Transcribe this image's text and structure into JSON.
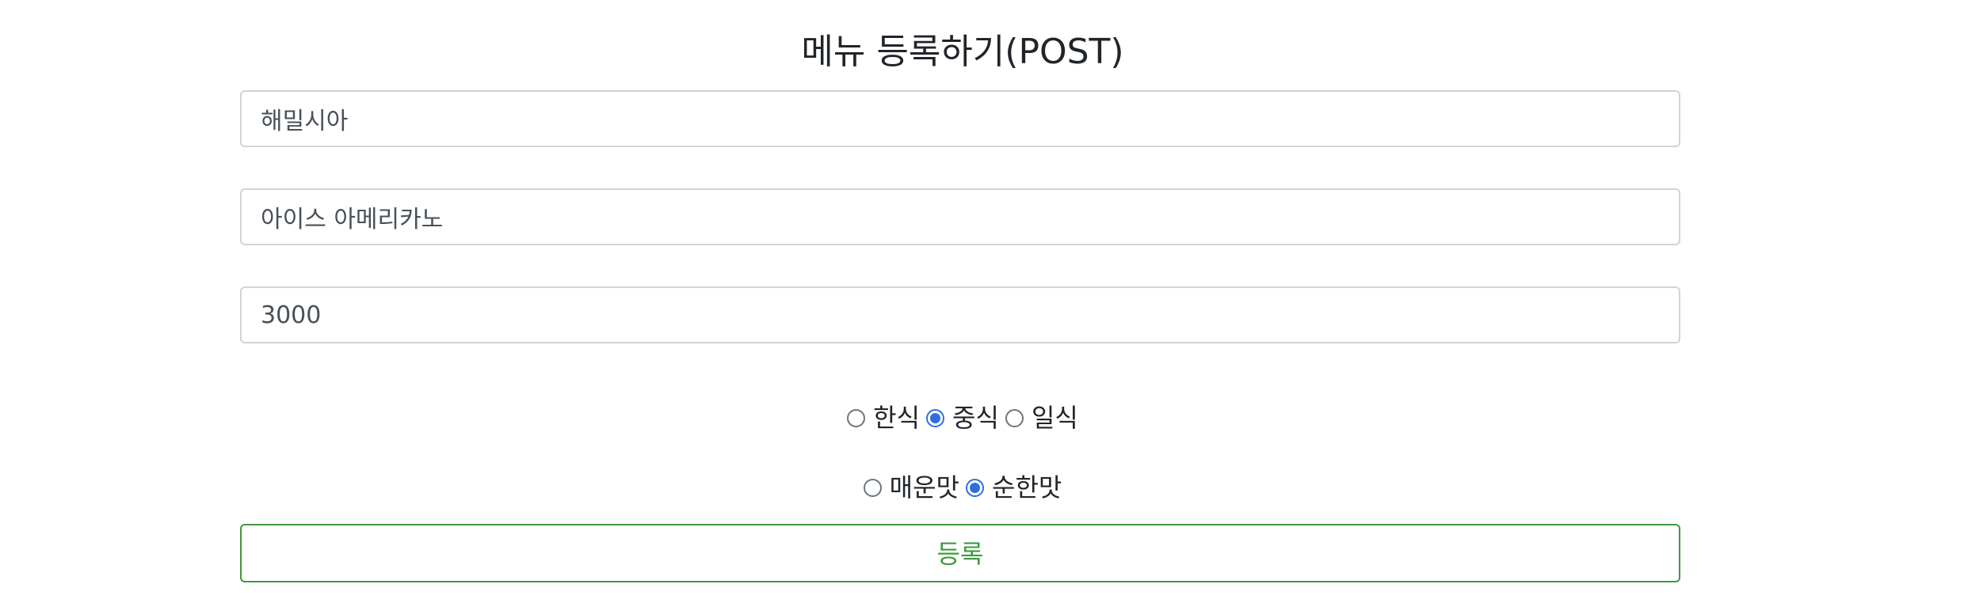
{
  "page": {
    "title": "메뉴 등록하기(POST)"
  },
  "form": {
    "store_field": {
      "value": "해밀시아"
    },
    "menu_field": {
      "value": "아이스 아메리카노"
    },
    "price_field": {
      "value": "3000"
    },
    "cuisine_options": [
      {
        "label": "한식",
        "checked": false
      },
      {
        "label": "중식",
        "checked": true
      },
      {
        "label": "일식",
        "checked": false
      }
    ],
    "taste_options": [
      {
        "label": "매운맛",
        "checked": false
      },
      {
        "label": "순한맛",
        "checked": true
      }
    ],
    "submit_label": "등록"
  },
  "colors": {
    "accent": "#2f6fdd",
    "submit": "#3f9a3f",
    "border": "#ced4da"
  }
}
